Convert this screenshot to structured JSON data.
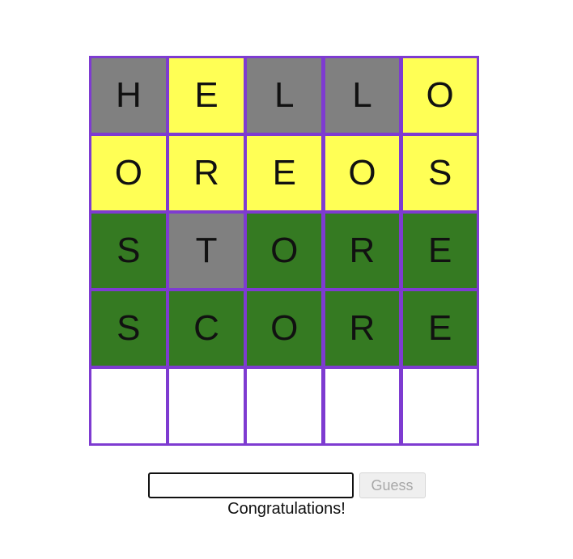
{
  "board": {
    "rows": [
      [
        {
          "letter": "H",
          "state": "gray"
        },
        {
          "letter": "E",
          "state": "yellow"
        },
        {
          "letter": "L",
          "state": "gray"
        },
        {
          "letter": "L",
          "state": "gray"
        },
        {
          "letter": "O",
          "state": "yellow"
        }
      ],
      [
        {
          "letter": "O",
          "state": "yellow"
        },
        {
          "letter": "R",
          "state": "yellow"
        },
        {
          "letter": "E",
          "state": "yellow"
        },
        {
          "letter": "O",
          "state": "yellow"
        },
        {
          "letter": "S",
          "state": "yellow"
        }
      ],
      [
        {
          "letter": "S",
          "state": "green"
        },
        {
          "letter": "T",
          "state": "gray"
        },
        {
          "letter": "O",
          "state": "green"
        },
        {
          "letter": "R",
          "state": "green"
        },
        {
          "letter": "E",
          "state": "green"
        }
      ],
      [
        {
          "letter": "S",
          "state": "green"
        },
        {
          "letter": "C",
          "state": "green"
        },
        {
          "letter": "O",
          "state": "green"
        },
        {
          "letter": "R",
          "state": "green"
        },
        {
          "letter": "E",
          "state": "green"
        }
      ],
      [
        {
          "letter": "",
          "state": "empty"
        },
        {
          "letter": "",
          "state": "empty"
        },
        {
          "letter": "",
          "state": "empty"
        },
        {
          "letter": "",
          "state": "empty"
        },
        {
          "letter": "",
          "state": "empty"
        }
      ]
    ],
    "colors": {
      "border": "#7e3bd1",
      "gray": "#808080",
      "yellow": "#ffff55",
      "green": "#357a22",
      "empty": "#ffffff"
    }
  },
  "guess": {
    "input_value": "",
    "button_label": "Guess",
    "button_disabled": true
  },
  "status": {
    "message": "Congratulations!"
  }
}
